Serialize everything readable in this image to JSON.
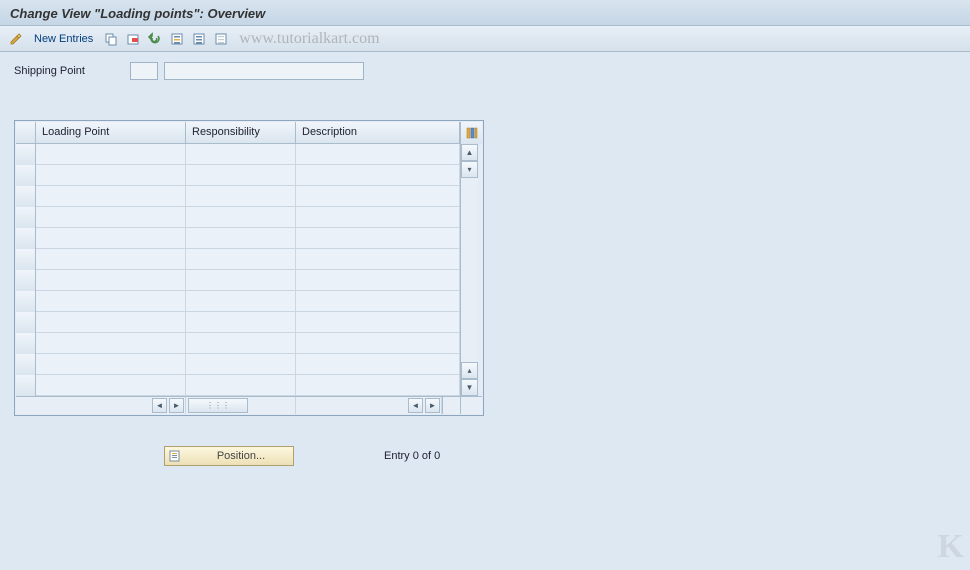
{
  "title": "Change View \"Loading points\": Overview",
  "toolbar": {
    "new_entries_label": "New Entries"
  },
  "watermark": "www.tutorialkart.com",
  "field": {
    "shipping_point_label": "Shipping Point",
    "shipping_point_value": "",
    "shipping_point_desc": ""
  },
  "table": {
    "columns": {
      "col1": "Loading Point",
      "col2": "Responsibility",
      "col3": "Description"
    },
    "rows": [
      {
        "loading_point": "",
        "responsibility": "",
        "description": ""
      },
      {
        "loading_point": "",
        "responsibility": "",
        "description": ""
      },
      {
        "loading_point": "",
        "responsibility": "",
        "description": ""
      },
      {
        "loading_point": "",
        "responsibility": "",
        "description": ""
      },
      {
        "loading_point": "",
        "responsibility": "",
        "description": ""
      },
      {
        "loading_point": "",
        "responsibility": "",
        "description": ""
      },
      {
        "loading_point": "",
        "responsibility": "",
        "description": ""
      },
      {
        "loading_point": "",
        "responsibility": "",
        "description": ""
      },
      {
        "loading_point": "",
        "responsibility": "",
        "description": ""
      },
      {
        "loading_point": "",
        "responsibility": "",
        "description": ""
      },
      {
        "loading_point": "",
        "responsibility": "",
        "description": ""
      },
      {
        "loading_point": "",
        "responsibility": "",
        "description": ""
      }
    ]
  },
  "footer": {
    "position_label": "Position...",
    "entry_text": "Entry 0 of 0"
  },
  "corner_logo": "K"
}
